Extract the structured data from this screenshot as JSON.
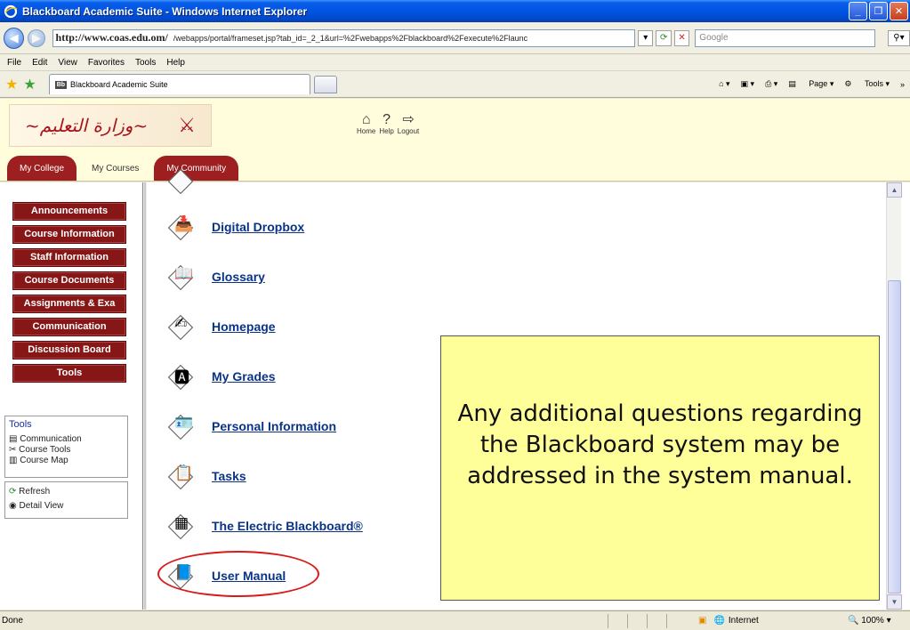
{
  "window": {
    "title": "Blackboard Academic Suite - Windows Internet Explorer"
  },
  "address": {
    "host": "http://www.coas.edu.om/",
    "path": "/webapps/portal/frameset.jsp?tab_id=_2_1&url=%2Fwebapps%2Fblackboard%2Fexecute%2Flaunc",
    "search_placeholder": "Google"
  },
  "menu": [
    "File",
    "Edit",
    "View",
    "Favorites",
    "Tools",
    "Help"
  ],
  "tabbar": {
    "tab_title": "Blackboard Academic Suite",
    "page_label": "Page",
    "tools_label": "Tools",
    "overflow": "»"
  },
  "header": {
    "home": "Home",
    "help": "Help",
    "logout": "Logout",
    "tabs": [
      "My College",
      "My Courses",
      "My Community"
    ],
    "active_tab": "My Courses"
  },
  "course_menu": [
    "Announcements",
    "Course Information",
    "Staff Information",
    "Course Documents",
    "Assignments & Exa",
    "Communication",
    "Discussion Board",
    "Tools"
  ],
  "tools_panel": {
    "title": "Tools",
    "items": [
      "Communication",
      "Course Tools",
      "Course Map"
    ]
  },
  "utility_panel": [
    "Refresh",
    "Detail View"
  ],
  "tool_list": [
    "Digital Dropbox",
    "Glossary",
    "Homepage",
    "My Grades",
    "Personal Information",
    "Tasks",
    "The Electric Blackboard®",
    "User Manual"
  ],
  "callout_text": "Any additional questions regarding the Blackboard system may be addressed in the system manual.",
  "status": {
    "text": "Done",
    "zone": "Internet",
    "zoom": "100%"
  },
  "colors": {
    "brand_red": "#9d1f20",
    "callout_bg": "#ffff99",
    "header_bg": "#fffddc",
    "link": "#0b3385"
  }
}
